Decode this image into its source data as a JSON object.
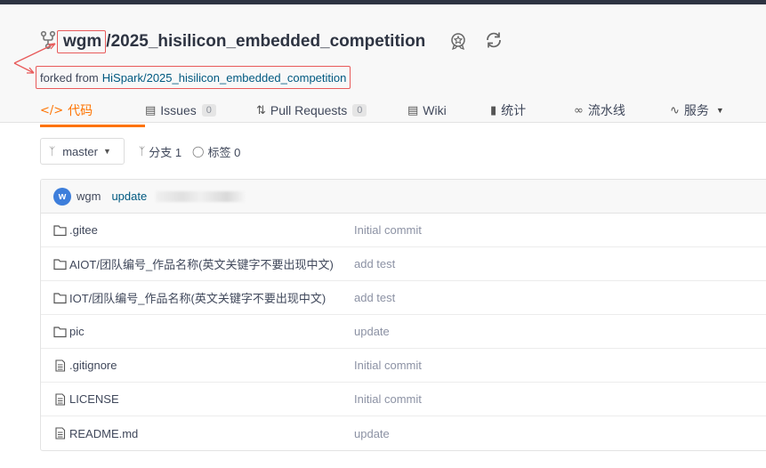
{
  "repo": {
    "owner": "wgm",
    "separator": "/",
    "name": "2025_hisilicon_embedded_competition",
    "forked_prefix": "forked from",
    "forked_source": "HiSpark/2025_hisilicon_embedded_competition"
  },
  "tabs": [
    {
      "icon": "code-icon",
      "label": "代码",
      "count": null
    },
    {
      "icon": "issues-icon",
      "label": "Issues",
      "count": "0"
    },
    {
      "icon": "pull-request-icon",
      "label": "Pull Requests",
      "count": "0"
    },
    {
      "icon": "wiki-icon",
      "label": "Wiki",
      "count": null
    },
    {
      "icon": "stats-icon",
      "label": "统计",
      "count": null
    },
    {
      "icon": "pipeline-icon",
      "label": "流水线",
      "count": null
    },
    {
      "icon": "service-icon",
      "label": "服务",
      "count": null
    }
  ],
  "branch": {
    "current": "master",
    "branches_label": "分支 1",
    "tags_label": "标签 0"
  },
  "latest_commit": {
    "avatar_letter": "w",
    "author": "wgm",
    "message": "update"
  },
  "files": [
    {
      "type": "folder",
      "name": ".gitee",
      "commit": "Initial commit"
    },
    {
      "type": "folder",
      "name": "AIOT/团队编号_作品名称(英文关键字不要出现中文)",
      "commit": "add test"
    },
    {
      "type": "folder",
      "name": "IOT/团队编号_作品名称(英文关键字不要出现中文)",
      "commit": "add test"
    },
    {
      "type": "folder",
      "name": "pic",
      "commit": "update"
    },
    {
      "type": "file",
      "name": ".gitignore",
      "commit": "Initial commit"
    },
    {
      "type": "file",
      "name": "LICENSE",
      "commit": "Initial commit"
    },
    {
      "type": "file",
      "name": "README.md",
      "commit": "update"
    }
  ],
  "colors": {
    "accent": "#fe7300",
    "link": "#005980",
    "annotation": "#e85a5a",
    "avatar": "#3d7edb"
  }
}
